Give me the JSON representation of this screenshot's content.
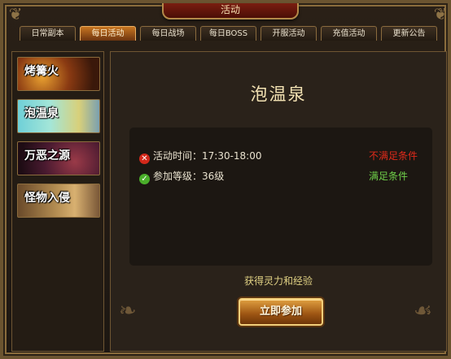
{
  "window": {
    "title": "活动"
  },
  "tabs": [
    {
      "label": "日常副本"
    },
    {
      "label": "每日活动",
      "active": true
    },
    {
      "label": "每日战场"
    },
    {
      "label": "每日BOSS"
    },
    {
      "label": "开服活动"
    },
    {
      "label": "充值活动"
    },
    {
      "label": "更新公告"
    }
  ],
  "events": [
    {
      "label": "烤篝火"
    },
    {
      "label": "泡温泉",
      "selected": true
    },
    {
      "label": "万恶之源"
    },
    {
      "label": "怪物入侵"
    }
  ],
  "detail": {
    "title": "泡温泉",
    "conditions": [
      {
        "label": "活动时间：17:30-18:00",
        "status": "不满足条件",
        "met": false
      },
      {
        "label": "参加等级：36级",
        "status": "满足条件",
        "met": true
      }
    ],
    "reward": "获得灵力和经验",
    "join_label": "立即参加"
  },
  "colors": {
    "active_tab": "#c77521",
    "not_met": "#e02a1a",
    "met": "#6fd04a",
    "reward_text": "#e0d184"
  }
}
